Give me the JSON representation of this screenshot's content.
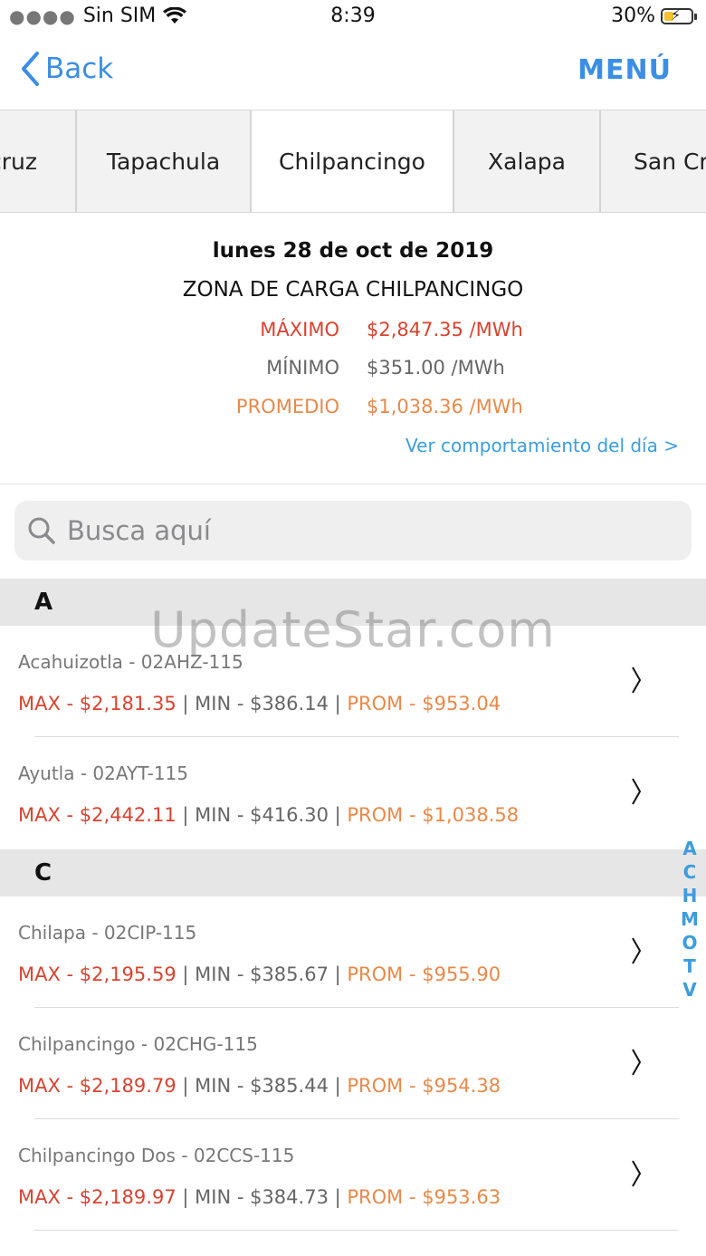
{
  "status_bar": {
    "carrier": "Sin SIM",
    "time": "8:39",
    "battery": "30%"
  },
  "nav": {
    "back_label": "Back",
    "menu_label": "MENÚ"
  },
  "tabs": [
    {
      "label": "cruz"
    },
    {
      "label": "Tapachula"
    },
    {
      "label": "Chilpancingo"
    },
    {
      "label": "Xalapa"
    },
    {
      "label": "San Cri"
    }
  ],
  "summary": {
    "date": "lunes 28 de oct de 2019",
    "zone": "ZONA DE CARGA CHILPANCINGO",
    "max_label": "MÁXIMO",
    "max_value": "$2,847.35 /MWh",
    "min_label": "MÍNIMO",
    "min_value": "$351.00 /MWh",
    "avg_label": "PROMEDIO",
    "avg_value": "$1,038.36 /MWh",
    "link": "Ver comportamiento del día >"
  },
  "search": {
    "placeholder": "Busca aquí"
  },
  "sections": [
    {
      "letter": "A",
      "rows": [
        {
          "name": "Acahuizotla - 02AHZ-115",
          "max": "MAX - $2,181.35",
          "min": "MIN - $386.14",
          "prom": "PROM - $953.04"
        },
        {
          "name": "Ayutla - 02AYT-115",
          "max": "MAX - $2,442.11",
          "min": "MIN - $416.30",
          "prom": "PROM - $1,038.58"
        }
      ]
    },
    {
      "letter": "C",
      "rows": [
        {
          "name": "Chilapa - 02CIP-115",
          "max": "MAX - $2,195.59",
          "min": "MIN - $385.67",
          "prom": "PROM - $955.90"
        },
        {
          "name": "Chilpancingo - 02CHG-115",
          "max": "MAX - $2,189.79",
          "min": "MIN - $385.44",
          "prom": "PROM - $954.38"
        },
        {
          "name": "Chilpancingo Dos - 02CCS-115",
          "max": "MAX - $2,189.97",
          "min": "MIN - $384.73",
          "prom": "PROM - $953.63"
        }
      ]
    }
  ],
  "separator": "|",
  "index_letters": [
    "A",
    "C",
    "H",
    "M",
    "O",
    "T",
    "V"
  ],
  "watermark": "UpdateStar.com",
  "colors": {
    "accent": "#3b8ee6",
    "max": "#d9432f",
    "min": "#666666",
    "prom": "#e8894a"
  }
}
